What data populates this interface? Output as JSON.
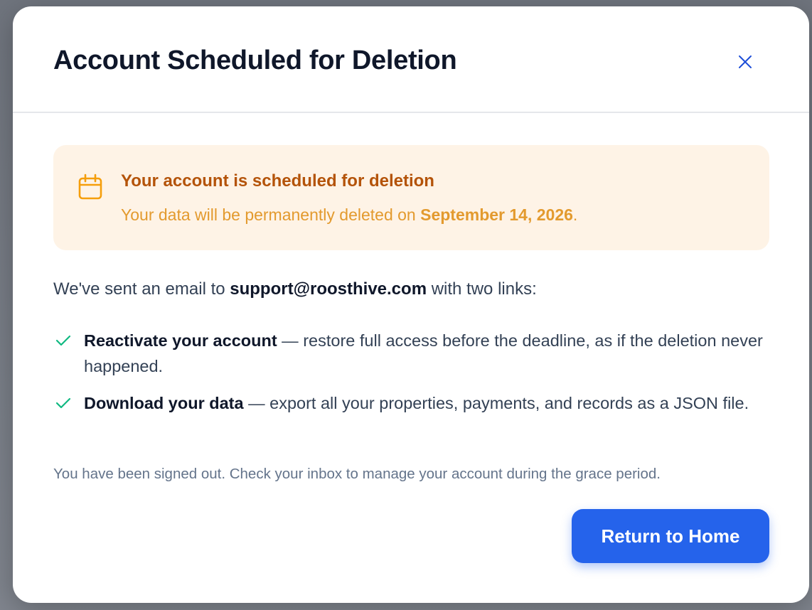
{
  "modal": {
    "title": "Account Scheduled for Deletion",
    "close_icon": "close-icon"
  },
  "alert": {
    "icon": "calendar-icon",
    "title": "Your account is scheduled for deletion",
    "text_prefix": "Your data will be permanently deleted on ",
    "deletion_date": "September 14, 2026",
    "text_suffix": "."
  },
  "intro": {
    "prefix": "We've sent an email to ",
    "email": "support@roosthive.com",
    "suffix": " with two links:"
  },
  "links": [
    {
      "icon": "check-icon",
      "title": "Reactivate your account",
      "description": " — restore full access before the deadline, as if the deletion never happened."
    },
    {
      "icon": "check-icon",
      "title": "Download your data",
      "description": " — export all your properties, payments, and records as a JSON file."
    }
  ],
  "footnote": "You have been signed out. Check your inbox to manage your account during the grace period.",
  "actions": {
    "return_label": "Return to Home"
  },
  "colors": {
    "primary": "#2563eb",
    "warning_bg": "#fef3e6",
    "warning_title": "#b45309",
    "warning_text": "#e39a2e",
    "success_check": "#10b981"
  }
}
